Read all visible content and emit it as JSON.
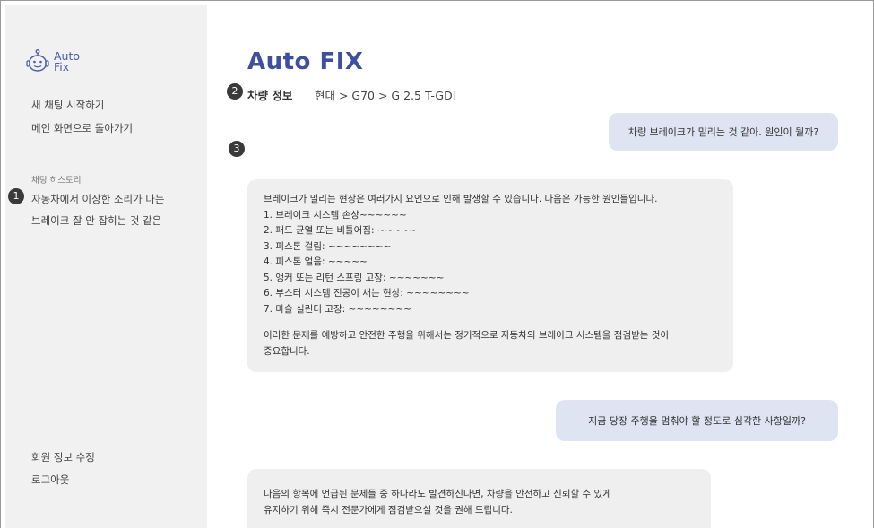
{
  "app": {
    "logo_line1": "Auto",
    "logo_line2": "Fix",
    "title": "Auto FIX",
    "brand_color": "#3d4f9e"
  },
  "sidebar": {
    "new_chat": "새 채팅 시작하기",
    "back_main": "메인 화면으로 돌아가기",
    "history_label": "채팅 히스토리",
    "history": [
      "자동차에서 이상한 소리가 나는",
      "브레이크 잘 안 잡히는 것 같은"
    ],
    "edit_profile": "회원 정보 수정",
    "logout": "로그아웃"
  },
  "badges": [
    "1",
    "2",
    "3"
  ],
  "vehicle": {
    "label": "차량 정보",
    "value": "현대 > G70 > G 2.5 T-GDI"
  },
  "messages": {
    "user1": "차량 브레이크가 밀리는 것 같아. 원인이 뭘까?",
    "bot1": [
      "브레이크가 밀리는 현상은 여러가지 요인으로 인해 발생할 수 있습니다. 다음은 가능한 원인들입니다.",
      " 1. 브레이크 시스템 손상~~~~~~",
      " 2. 패드 균열 또는 비틀어짐: ~~~~~",
      " 3. 피스톤 걸림: ~~~~~~~~",
      " 4. 피스톤 얼음: ~~~~~",
      " 5. 앵커 또는 리턴 스프링 고장: ~~~~~~~",
      " 6. 부스터 시스템 진공이 새는 현상: ~~~~~~~~",
      " 7. 마슬 실린더 고장: ~~~~~~~~",
      "",
      "이러한 문제를 예방하고 안전한 주행을 위해서는 정기적으로 자동차의 브레이크 시스템을 점검받는 것이",
      "중요합니다."
    ],
    "user2": "지금 당장 주행을 멈춰야 할 정도로 심각한 사항일까?",
    "bot2": [
      "다음의 항목에 언급된 문제들 중 하나라도 발견하신다면, 차량을 안전하고 신뢰할 수 있게",
      "유지하기 위해 즉시 전문가에게 점검받으실 것을 권해 드립니다."
    ]
  }
}
